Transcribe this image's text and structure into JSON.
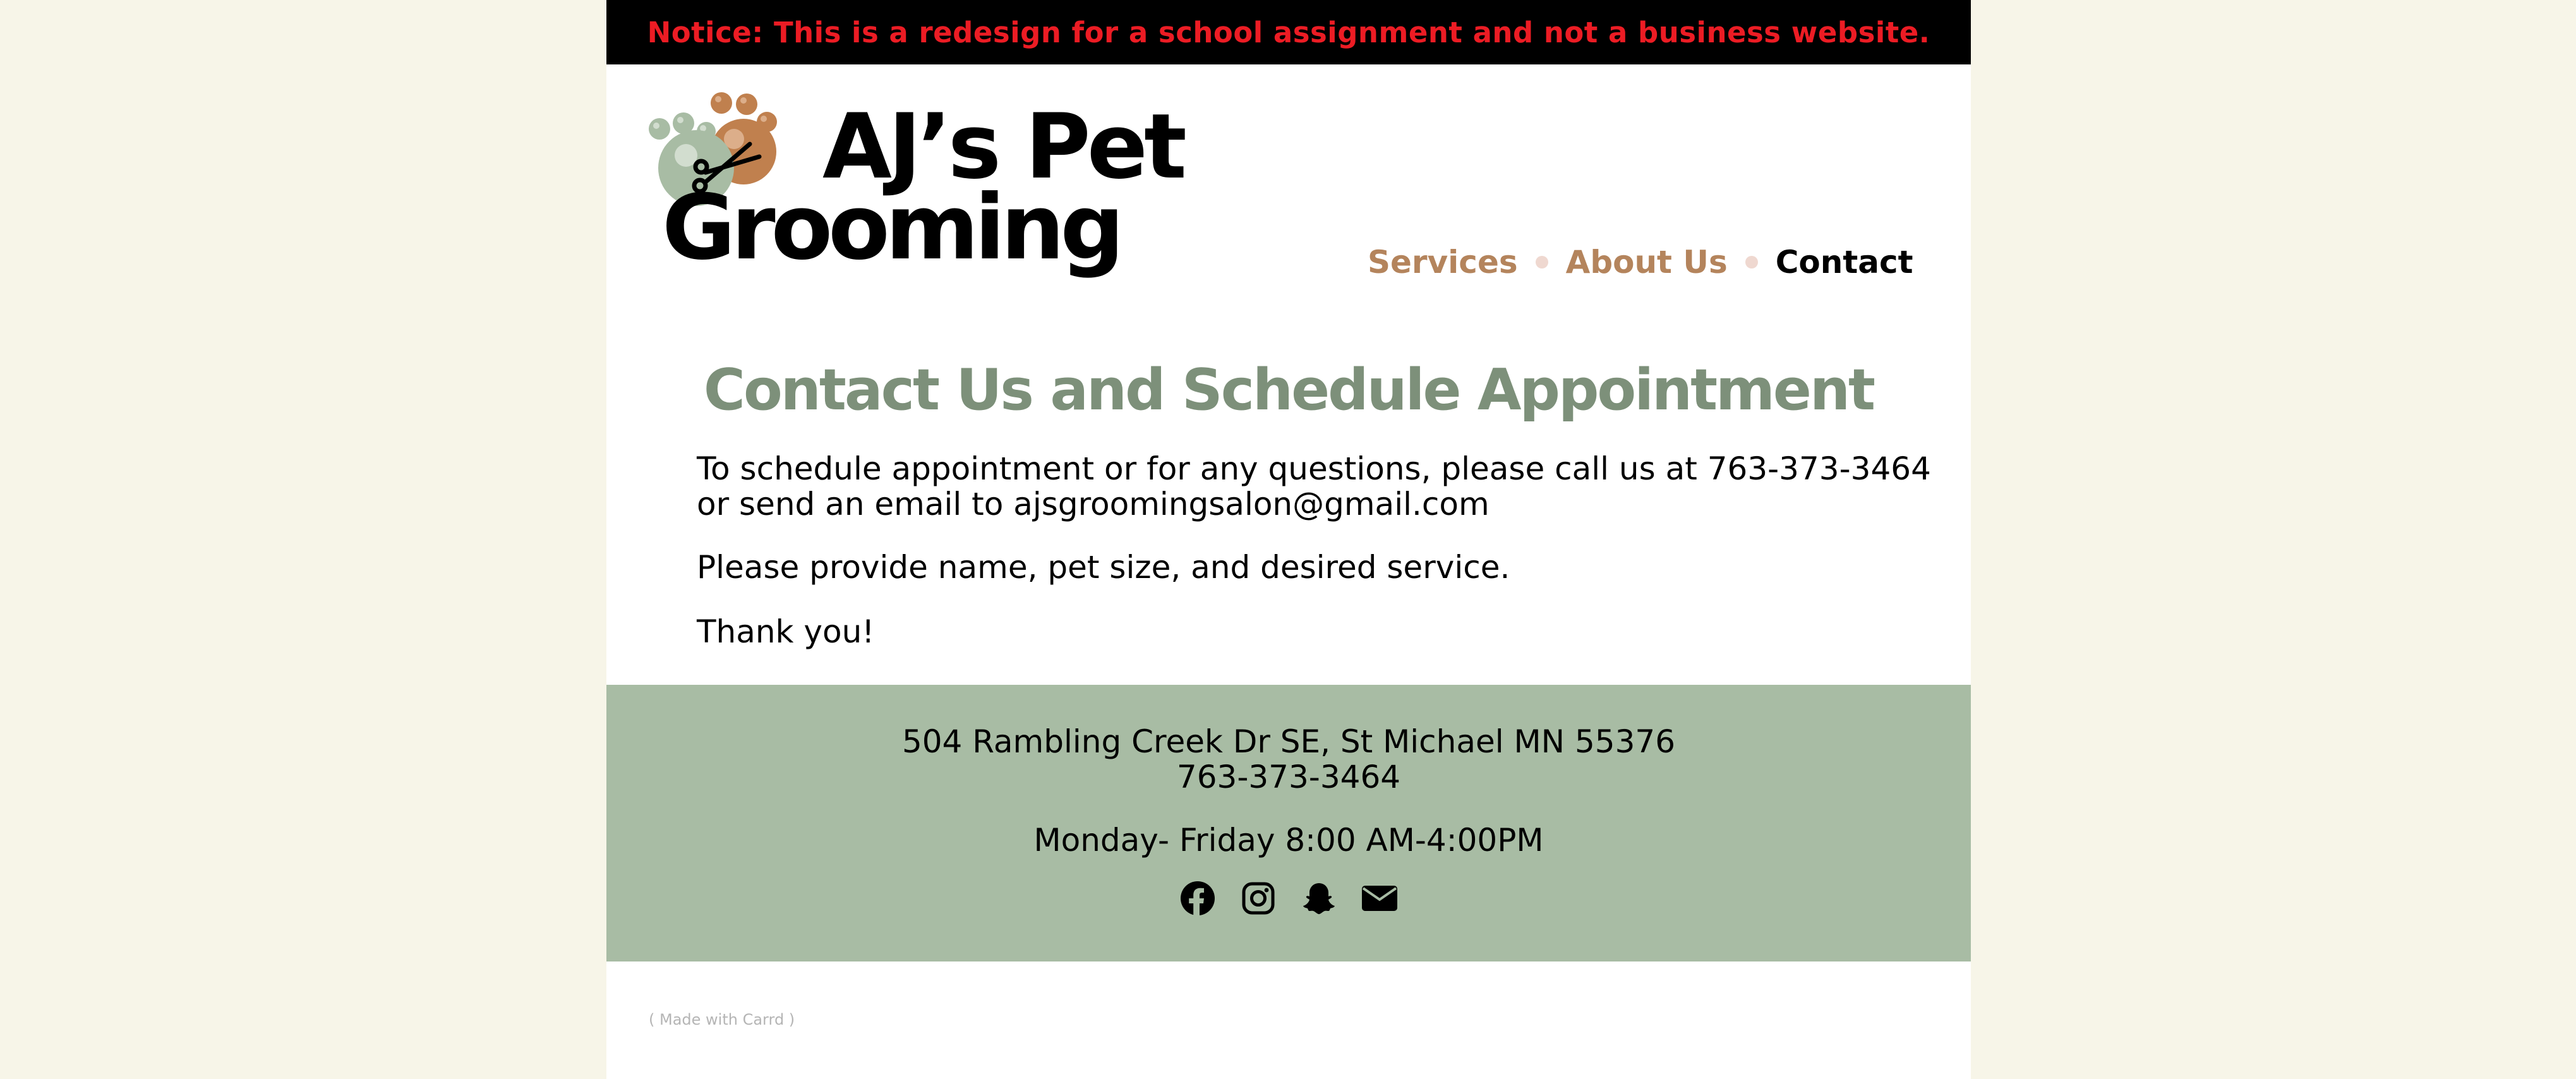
{
  "notice": {
    "text": "Notice: This is a redesign for a school assignment and not a business website."
  },
  "logo": {
    "line1": "AJ’s Pet",
    "line2": "Grooming"
  },
  "nav": {
    "items": [
      {
        "label": "Services"
      },
      {
        "label": "About Us"
      },
      {
        "label": "Contact"
      }
    ],
    "active": "Contact"
  },
  "main": {
    "title": "Contact Us and Schedule Appointment",
    "paragraph1_line1": "To schedule appointment or for any questions, please call us at 763-373-3464",
    "paragraph1_line2": "or send an email to ajsgroomingsalon@gmail.com",
    "paragraph2": "Please provide name, pet size, and desired service.",
    "paragraph3": "Thank you!"
  },
  "footer": {
    "address": "504 Rambling Creek Dr SE, St Michael MN 55376",
    "phone": "763-373-3464",
    "hours": "Monday- Friday 8:00 AM-4:00PM",
    "social_icons": [
      "facebook-icon",
      "instagram-icon",
      "snapchat-icon",
      "email-icon"
    ]
  },
  "made_with": "( Made with Carrd )",
  "colors": {
    "background": "#f7f5e8",
    "notice_bg": "#000000",
    "notice_text": "#ec1c24",
    "nav_link": "#b4845c",
    "nav_dot": "#efd8d0",
    "title": "#7d907a",
    "footer_bg": "#a8bca4",
    "paw_green": "#a8bca4",
    "paw_brown": "#c0804e"
  }
}
